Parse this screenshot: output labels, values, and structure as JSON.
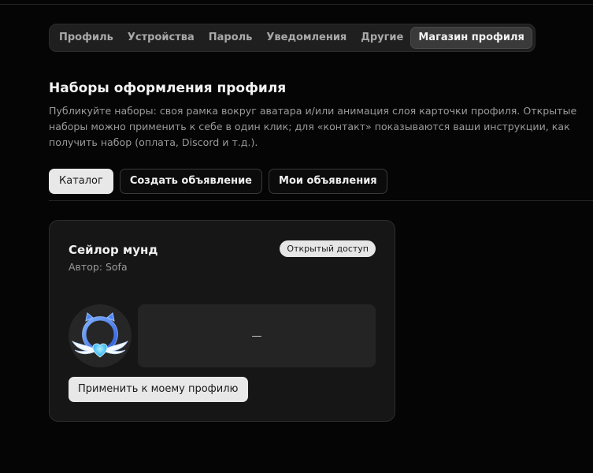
{
  "nav": {
    "tabs": [
      {
        "label": "Профиль"
      },
      {
        "label": "Устройства"
      },
      {
        "label": "Пароль"
      },
      {
        "label": "Уведомления"
      },
      {
        "label": "Другие"
      },
      {
        "label": "Магазин профиля"
      }
    ],
    "active_tab": "Магазин профиля"
  },
  "section": {
    "title": "Наборы оформления профиля",
    "description": "Публикуйте наборы: своя рамка вокруг аватара и/или анимация слоя карточки профиля. Открытые наборы можно применить к себе в один клик; для «контакт» показываются ваши инструкции, как получить набор (оплата, Discord и т.д.)."
  },
  "subtabs": [
    {
      "label": "Каталог"
    },
    {
      "label": "Создать объявление"
    },
    {
      "label": "Мои объявления"
    }
  ],
  "active_subtab": "Каталог",
  "card": {
    "title": "Сейлор мунд",
    "author": "Автор: Sofa",
    "badge": "Открытый доступ",
    "preview_text": "—",
    "avatar_icon": "winged-heart-frame-icon",
    "apply_label": "Применить к моему профилю"
  },
  "colors": {
    "background": "#050505",
    "card": "#161616",
    "frame_blue": "#3a7bff",
    "heart_cyan": "#35c8ff"
  }
}
